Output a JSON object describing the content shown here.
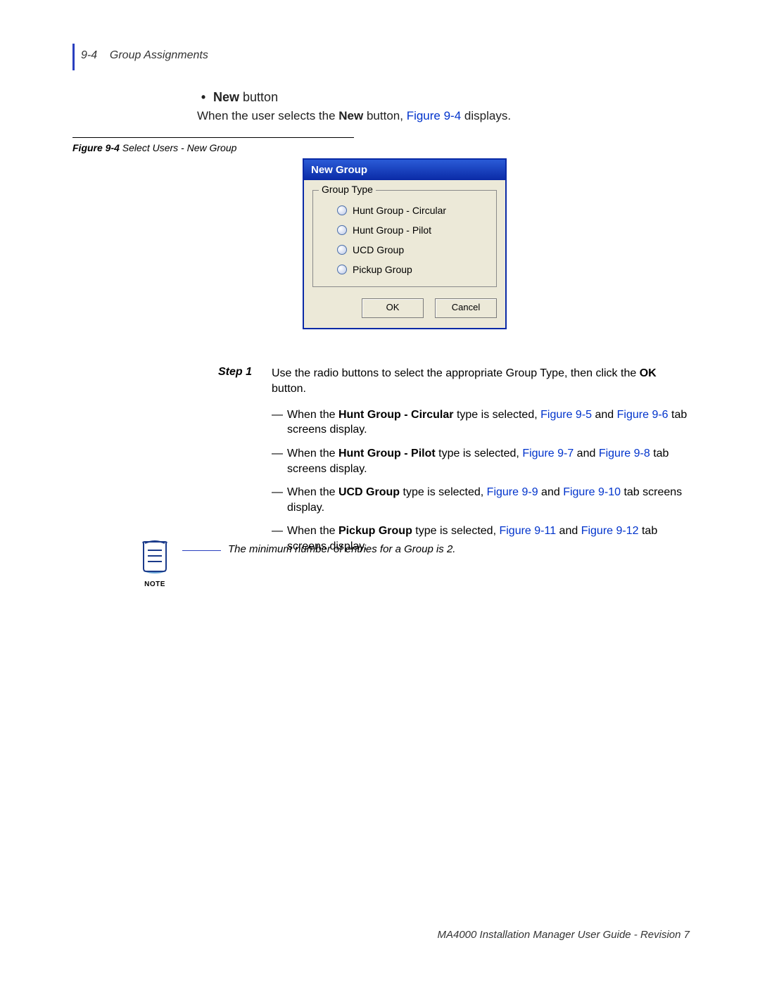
{
  "header": {
    "pageRef": "9-4",
    "section": "Group Assignments"
  },
  "intro": {
    "bulletLabelStrong": "New",
    "bulletLabelRest": " button",
    "descPrefix": "When the user selects the ",
    "descStrong": "New",
    "descMid": " button, ",
    "descLink": "Figure 9-4",
    "descSuffix": " displays."
  },
  "figure": {
    "ref": "Figure 9-4",
    "title": "  Select Users - New Group"
  },
  "dialog": {
    "title": "New Group",
    "legend": "Group Type",
    "options": [
      "Hunt Group - Circular",
      "Hunt Group - Pilot",
      "UCD Group",
      "Pickup Group"
    ],
    "okLabel": "OK",
    "cancelLabel": "Cancel"
  },
  "step": {
    "label": "Step  1",
    "text1": "Use the radio buttons to select the appropriate Group Type, then click the ",
    "textStrong": "OK",
    "text2": " button.",
    "items": [
      {
        "prefix": "When the ",
        "strong": "Hunt Group - Circular",
        "mid": " type is selected, ",
        "link1": "Figure 9-5",
        "between": " and ",
        "link2": "Figure 9-6",
        "suffix": " tab screens display."
      },
      {
        "prefix": "When the ",
        "strong": "Hunt Group - Pilot",
        "mid": " type is selected, ",
        "link1": "Figure 9-7",
        "between": " and ",
        "link2": "Figure 9-8",
        "suffix": " tab screens display."
      },
      {
        "prefix": "When the ",
        "strong": "UCD Group",
        "mid": " type is selected, ",
        "link1": "Figure 9-9",
        "between": " and ",
        "link2": "Figure 9-10",
        "suffix": " tab screens display."
      },
      {
        "prefix": "When the ",
        "strong": "Pickup Group",
        "mid": " type is selected, ",
        "link1": "Figure 9-11",
        "between": " and ",
        "link2": "Figure 9-12",
        "suffix": " tab screens display."
      }
    ]
  },
  "note": {
    "label": "NOTE",
    "text": "The minimum number of entries for a Group is 2."
  },
  "footer": "MA4000 Installation Manager User Guide - Revision 7",
  "glyphs": {
    "bullet": "•",
    "mdash": "—"
  }
}
